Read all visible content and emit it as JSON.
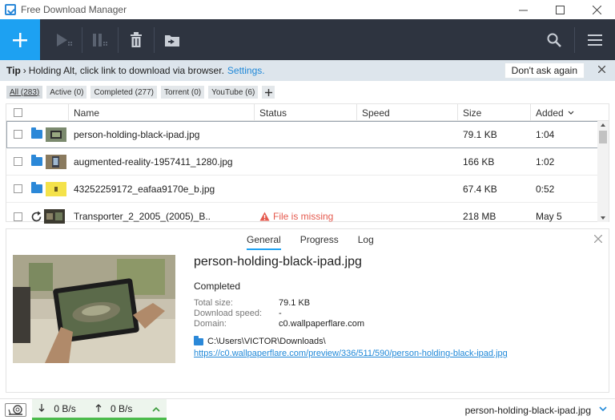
{
  "window": {
    "title": "Free Download Manager"
  },
  "tip": {
    "label": "Tip",
    "sep": "›",
    "text": "Holding Alt, click link to download via browser.",
    "link": "Settings.",
    "dont_ask": "Don't ask again"
  },
  "filters": [
    {
      "label": "All (283)",
      "active": true
    },
    {
      "label": "Active (0)",
      "active": false
    },
    {
      "label": "Completed (277)",
      "active": false
    },
    {
      "label": "Torrent (0)",
      "active": false
    },
    {
      "label": "YouTube (6)",
      "active": false
    }
  ],
  "table": {
    "columns": {
      "name": "Name",
      "status": "Status",
      "speed": "Speed",
      "size": "Size",
      "added": "Added"
    },
    "rows": [
      {
        "name": "person-holding-black-ipad.jpg",
        "status": "",
        "speed": "",
        "size": "79.1 KB",
        "added": "1:04"
      },
      {
        "name": "augmented-reality-1957411_1280.jpg",
        "status": "",
        "speed": "",
        "size": "166 KB",
        "added": "1:02"
      },
      {
        "name": "43252259172_eafaa9170e_b.jpg",
        "status": "",
        "speed": "",
        "size": "67.4 KB",
        "added": "0:52"
      },
      {
        "name": "Transporter_2_2005_(2005)_B..",
        "status": "File is missing",
        "speed": "",
        "size": "218 MB",
        "added": "May 5"
      }
    ]
  },
  "details": {
    "tabs": [
      "General",
      "Progress",
      "Log"
    ],
    "file_name": "person-holding-black-ipad.jpg",
    "status": "Completed",
    "total_size_label": "Total size:",
    "total_size": "79.1 KB",
    "speed_label": "Download speed:",
    "speed": "-",
    "domain_label": "Domain:",
    "domain": "c0.wallpaperflare.com",
    "path": "C:\\Users\\VICTOR\\Downloads\\",
    "url": "https://c0.wallpaperflare.com/preview/336/511/590/person-holding-black-ipad.jpg"
  },
  "statusbar": {
    "down": "0 B/s",
    "up": "0 B/s",
    "file": "person-holding-black-ipad.jpg"
  },
  "colors": {
    "accent": "#1da1f2",
    "toolbar": "#2e3440",
    "error": "#e55a4e"
  }
}
